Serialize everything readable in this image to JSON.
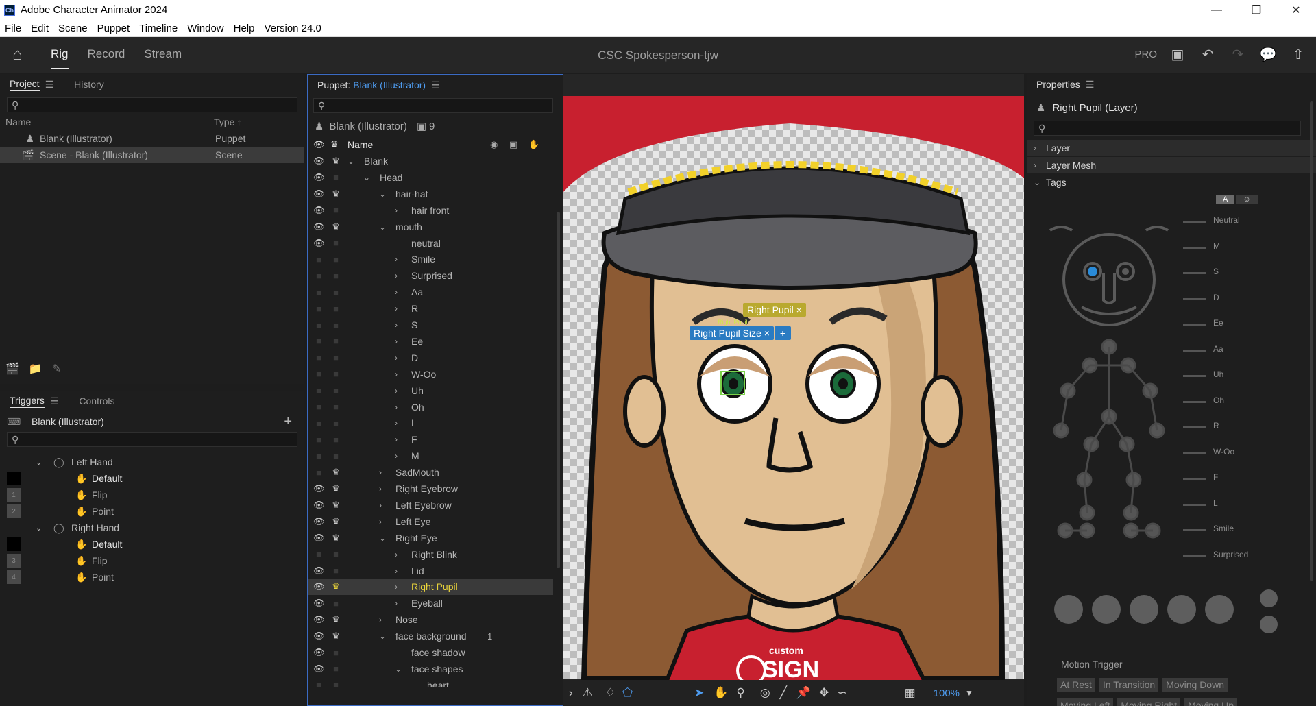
{
  "app": {
    "title": "Adobe Character Animator 2024",
    "icon_label": "Ch",
    "window_buttons": [
      "minimize-icon",
      "restore-icon",
      "close-icon"
    ]
  },
  "menu": [
    "File",
    "Edit",
    "Scene",
    "Puppet",
    "Timeline",
    "Window",
    "Help",
    "Version 24.0"
  ],
  "toolbar": {
    "modes": [
      "Rig",
      "Record",
      "Stream"
    ],
    "active_mode": "Rig",
    "document_title": "CSC Spokesperson-tjw",
    "pro_label": "PRO"
  },
  "project_panel": {
    "tabs": [
      "Project",
      "History"
    ],
    "columns": [
      "Name",
      "Type"
    ],
    "items": [
      {
        "name": "Blank (Illustrator)",
        "type": "Puppet"
      },
      {
        "name": "Scene - Blank (Illustrator)",
        "type": "Scene"
      }
    ]
  },
  "triggers_panel": {
    "tabs": [
      "Triggers",
      "Controls"
    ],
    "puppet_name": "Blank (Illustrator)",
    "groups": [
      {
        "name": "Left Hand",
        "items": [
          "Default",
          "Flip",
          "Point"
        ],
        "keys": [
          "",
          "1",
          "2"
        ]
      },
      {
        "name": "Right Hand",
        "items": [
          "Default",
          "Flip",
          "Point"
        ],
        "keys": [
          "",
          "3",
          "4"
        ]
      }
    ]
  },
  "puppet_panel": {
    "title_prefix": "Puppet:",
    "title_name": "Blank (Illustrator)",
    "puppet_label": "Blank (Illustrator)",
    "behavior_count": "9",
    "name_header": "Name",
    "rows": [
      {
        "label": "Blank",
        "indent": 0,
        "caret": "v",
        "eye": true,
        "crown": true
      },
      {
        "label": "Head",
        "indent": 1,
        "caret": "v",
        "eye": true,
        "crown": false
      },
      {
        "label": "hair-hat",
        "indent": 2,
        "caret": "v",
        "eye": true,
        "crown": true
      },
      {
        "label": "hair front",
        "indent": 3,
        "caret": ">",
        "eye": true,
        "crown": false
      },
      {
        "label": "mouth",
        "indent": 2,
        "caret": "v",
        "eye": true,
        "crown": true
      },
      {
        "label": "neutral",
        "indent": 3,
        "caret": "",
        "eye": true,
        "crown": false
      },
      {
        "label": "Smile",
        "indent": 3,
        "caret": ">",
        "eye": false,
        "crown": false
      },
      {
        "label": "Surprised",
        "indent": 3,
        "caret": ">",
        "eye": false,
        "crown": false
      },
      {
        "label": "Aa",
        "indent": 3,
        "caret": ">",
        "eye": false,
        "crown": false
      },
      {
        "label": "R",
        "indent": 3,
        "caret": ">",
        "eye": false,
        "crown": false
      },
      {
        "label": "S",
        "indent": 3,
        "caret": ">",
        "eye": false,
        "crown": false
      },
      {
        "label": "Ee",
        "indent": 3,
        "caret": ">",
        "eye": false,
        "crown": false
      },
      {
        "label": "D",
        "indent": 3,
        "caret": ">",
        "eye": false,
        "crown": false
      },
      {
        "label": "W-Oo",
        "indent": 3,
        "caret": ">",
        "eye": false,
        "crown": false
      },
      {
        "label": "Uh",
        "indent": 3,
        "caret": ">",
        "eye": false,
        "crown": false
      },
      {
        "label": "Oh",
        "indent": 3,
        "caret": ">",
        "eye": false,
        "crown": false
      },
      {
        "label": "L",
        "indent": 3,
        "caret": ">",
        "eye": false,
        "crown": false
      },
      {
        "label": "F",
        "indent": 3,
        "caret": ">",
        "eye": false,
        "crown": false
      },
      {
        "label": "M",
        "indent": 3,
        "caret": ">",
        "eye": false,
        "crown": false
      },
      {
        "label": "SadMouth",
        "indent": 2,
        "caret": ">",
        "eye": false,
        "crown": true
      },
      {
        "label": "Right Eyebrow",
        "indent": 2,
        "caret": ">",
        "eye": true,
        "crown": true
      },
      {
        "label": "Left Eyebrow",
        "indent": 2,
        "caret": ">",
        "eye": true,
        "crown": true
      },
      {
        "label": "Left Eye",
        "indent": 2,
        "caret": ">",
        "eye": true,
        "crown": true
      },
      {
        "label": "Right Eye",
        "indent": 2,
        "caret": "v",
        "eye": true,
        "crown": true
      },
      {
        "label": "Right Blink",
        "indent": 3,
        "caret": ">",
        "eye": false,
        "crown": false
      },
      {
        "label": "Lid",
        "indent": 3,
        "caret": ">",
        "eye": true,
        "crown": false
      },
      {
        "label": "Right Pupil",
        "indent": 3,
        "caret": ">",
        "eye": true,
        "crown": true,
        "selected": true
      },
      {
        "label": "Eyeball",
        "indent": 3,
        "caret": ">",
        "eye": true,
        "crown": false
      },
      {
        "label": "Nose",
        "indent": 2,
        "caret": ">",
        "eye": true,
        "crown": true
      },
      {
        "label": "face background",
        "indent": 2,
        "caret": "v",
        "eye": true,
        "crown": true,
        "count": "1"
      },
      {
        "label": "face shadow",
        "indent": 3,
        "caret": "",
        "eye": true,
        "crown": false
      },
      {
        "label": "face shapes",
        "indent": 3,
        "caret": "v",
        "eye": true,
        "crown": false
      },
      {
        "label": "heart",
        "indent": 4,
        "caret": "",
        "eye": false,
        "crown": false
      }
    ]
  },
  "canvas": {
    "handle_labels": [
      "Right Pupil",
      "Right Pupil Size"
    ],
    "tiny_label": "Right Pupil",
    "shirt_text": "SIGN",
    "shirt_small": "custom",
    "zoom": "100%"
  },
  "properties_panel": {
    "title": "Properties",
    "layer_name": "Right Pupil (Layer)",
    "sections": [
      "Layer",
      "Layer Mesh",
      "Tags"
    ],
    "tag_toggle": [
      "A",
      "☺"
    ],
    "viseme_tags": [
      "Neutral",
      "M",
      "S",
      "D",
      "Ee",
      "Aa",
      "Uh",
      "Oh",
      "R",
      "W-Oo",
      "F",
      "L",
      "Smile",
      "Surprised"
    ],
    "motion_trigger_title": "Motion Trigger",
    "motion_chips": [
      "At Rest",
      "In Transition",
      "Moving Down"
    ],
    "motion_chips_row2": [
      "Moving Left",
      "Moving Right",
      "Moving Up"
    ]
  }
}
